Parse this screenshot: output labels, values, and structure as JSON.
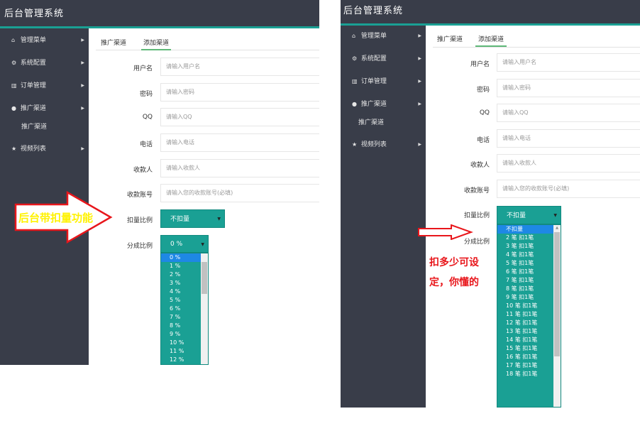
{
  "app": {
    "title": "后台管理系统"
  },
  "sidebar": {
    "items": [
      {
        "label": "管理菜单",
        "icon": "home-icon"
      },
      {
        "label": "系统配置",
        "icon": "cogs-icon"
      },
      {
        "label": "订单管理",
        "icon": "bar-chart-icon"
      },
      {
        "label": "推广渠道",
        "icon": "user-icon"
      },
      {
        "label": "视频列表",
        "icon": "star-icon"
      }
    ],
    "subitem": "推广渠道"
  },
  "tabs": [
    "推广渠道",
    "添加渠道"
  ],
  "form": {
    "fields": [
      {
        "label": "用户名",
        "placeholder": "请输入用户名"
      },
      {
        "label": "密码",
        "placeholder": "请输入密码"
      },
      {
        "label": "QQ",
        "placeholder": "请输入QQ"
      },
      {
        "label": "电话",
        "placeholder": "请输入电话"
      },
      {
        "label": "收款人",
        "placeholder": "请输入收款人"
      },
      {
        "label": "收款账号",
        "placeholder": "请输入您的收款账号(必填)"
      }
    ],
    "deduct_label": "扣量比例",
    "deduct_value": "不扣量",
    "share_label": "分成比例",
    "share_value": "0 %"
  },
  "share_options": [
    "0 %",
    "1 %",
    "2 %",
    "3 %",
    "4 %",
    "5 %",
    "6 %",
    "7 %",
    "8 %",
    "9 %",
    "10 %",
    "11 %",
    "12 %"
  ],
  "deduct_options": [
    "不扣量",
    "2 笔 扣1笔",
    "3 笔 扣1笔",
    "4 笔 扣1笔",
    "5 笔 扣1笔",
    "6 笔 扣1笔",
    "7 笔 扣1笔",
    "8 笔 扣1笔",
    "9 笔 扣1笔",
    "10 笔 扣1笔",
    "11 笔 扣1笔",
    "12 笔 扣1笔",
    "13 笔 扣1笔",
    "14 笔 扣1笔",
    "15 笔 扣1笔",
    "16 笔 扣1笔",
    "17 笔 扣1笔",
    "18 笔 扣1笔"
  ],
  "annotations": {
    "left": "后台带扣量功能",
    "right_line1": "扣多少可设",
    "right_line2": "定，你懂的"
  },
  "colors": {
    "sidebar": "#393d49",
    "accent": "#1aa094",
    "selected_option": "#1e88e5",
    "arrow_red": "#e8161b",
    "annot_yellow": "#fff200"
  }
}
